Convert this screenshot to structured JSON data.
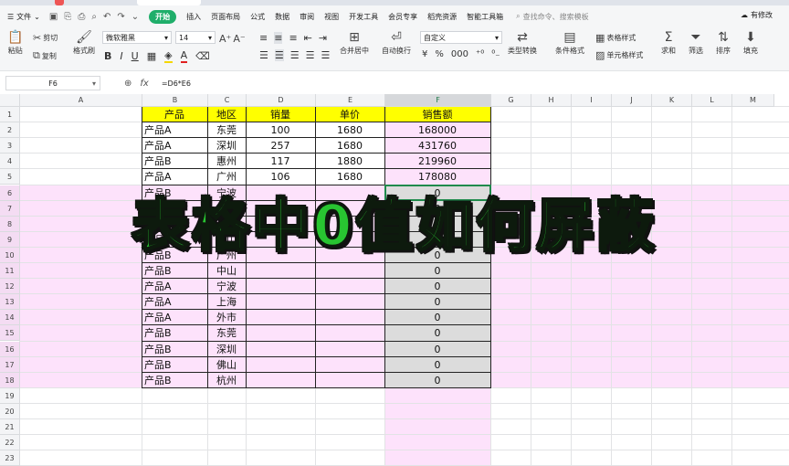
{
  "app": {
    "file_menu": "文件",
    "menus": [
      "开始",
      "插入",
      "页面布局",
      "公式",
      "数据",
      "审阅",
      "视图",
      "开发工具",
      "会员专享",
      "稻壳资源",
      "智能工具箱"
    ],
    "active_menu": "开始",
    "search_placeholder": "查找命令、搜索模板",
    "collab_label": "有修改"
  },
  "toolbar": {
    "paste": "粘贴",
    "cut": "剪切",
    "copy": "复制",
    "format_painter": "格式刷",
    "font_name": "微软雅黑",
    "font_size": "14",
    "merge_center": "合并居中",
    "auto_wrap": "自动换行",
    "number_format": "自定义",
    "type_convert": "类型转换",
    "conditional_format": "条件格式",
    "table_style": "表格样式",
    "cell_style": "单元格样式",
    "sum": "求和",
    "filter": "筛选",
    "sort": "排序",
    "fill": "填充",
    "bold": "B",
    "italic": "I",
    "underline": "U",
    "percent": "%",
    "thousands": "000"
  },
  "formula_bar": {
    "name_box": "F6",
    "fx_label": "fx",
    "formula": "=D6*E6"
  },
  "sheet": {
    "columns": [
      "A",
      "B",
      "C",
      "D",
      "E",
      "F",
      "G",
      "H",
      "I",
      "J",
      "K",
      "L",
      "M"
    ],
    "selected_column": "F",
    "rows": [
      "1",
      "2",
      "3",
      "4",
      "5",
      "6",
      "7",
      "8",
      "9",
      "10",
      "11",
      "12",
      "13",
      "14",
      "15",
      "16",
      "17",
      "18",
      "19",
      "20",
      "21",
      "22",
      "23"
    ],
    "header": [
      "产品",
      "地区",
      "销量",
      "单价",
      "销售额"
    ],
    "data": [
      [
        "产品A",
        "东莞",
        "100",
        "1680",
        "168000"
      ],
      [
        "产品A",
        "深圳",
        "257",
        "1680",
        "431760"
      ],
      [
        "产品B",
        "惠州",
        "117",
        "1880",
        "219960"
      ],
      [
        "产品A",
        "广州",
        "106",
        "1680",
        "178080"
      ],
      [
        "产品B",
        "宁波",
        "",
        "",
        "0"
      ],
      [
        "产品B",
        "上海",
        "",
        "",
        "0"
      ],
      [
        "产品A",
        "外市",
        "",
        "",
        "0"
      ],
      [
        "产品A",
        "佛山",
        "",
        "",
        "0"
      ],
      [
        "产品B",
        "广州",
        "",
        "",
        "0"
      ],
      [
        "产品B",
        "中山",
        "",
        "",
        "0"
      ],
      [
        "产品A",
        "宁波",
        "",
        "",
        "0"
      ],
      [
        "产品A",
        "上海",
        "",
        "",
        "0"
      ],
      [
        "产品A",
        "外市",
        "",
        "",
        "0"
      ],
      [
        "产品B",
        "东莞",
        "",
        "",
        "0"
      ],
      [
        "产品B",
        "深圳",
        "",
        "",
        "0"
      ],
      [
        "产品B",
        "佛山",
        "",
        "",
        "0"
      ],
      [
        "产品B",
        "杭州",
        "",
        "",
        "0"
      ]
    ]
  },
  "overlay": {
    "title": "表格中0值如何屏蔽"
  },
  "colors": {
    "header_fill": "#ffff00",
    "sales_fill": "#fde2fb",
    "selected_col_fill": "#dcdcdc",
    "row_highlight": "#fde2fb",
    "accent_green": "#1fae6a",
    "overlay_text": "#28c431"
  }
}
